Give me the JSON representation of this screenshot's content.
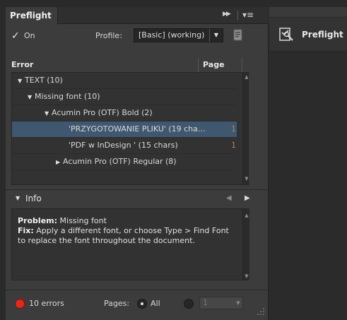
{
  "panel": {
    "tab_title": "Preflight",
    "on_label": "On",
    "profile_label": "Profile:",
    "profile_value": "[Basic] (working)"
  },
  "errors": {
    "col_error": "Error",
    "col_page": "Page",
    "rows": [
      {
        "label": "TEXT (10)",
        "page": "",
        "indent": 0,
        "expanded": true,
        "selected": false
      },
      {
        "label": "Missing font (10)",
        "page": "",
        "indent": 1,
        "expanded": true,
        "selected": false
      },
      {
        "label": "Acumin Pro (OTF) Bold (2)",
        "page": "",
        "indent": 2,
        "expanded": true,
        "selected": false
      },
      {
        "label": "'PRZYGOTOWANIE PLIKU' (19 cha...",
        "page": "1",
        "indent": 3,
        "expanded": null,
        "selected": true
      },
      {
        "label": "'PDF w InDesign ' (15 chars)",
        "page": "1",
        "indent": 3,
        "expanded": null,
        "selected": false
      },
      {
        "label": "Acumin Pro (OTF) Regular (8)",
        "page": "",
        "indent": 2,
        "expanded": false,
        "selected": false
      }
    ]
  },
  "info": {
    "label": "Info",
    "problem_label": "Problem:",
    "problem_text": "Missing font",
    "fix_label": "Fix:",
    "fix_text": "Apply a different font, or choose Type > Find Font to replace the font throughout the document."
  },
  "footer": {
    "status": "10 errors",
    "pages_label": "Pages:",
    "all_label": "All",
    "range_value": "1"
  },
  "dock": {
    "label": "Preflight"
  },
  "colors": {
    "selected_row": "#3f5870",
    "error_dot": "#e02a1e",
    "page_number": "#c97b3f"
  }
}
